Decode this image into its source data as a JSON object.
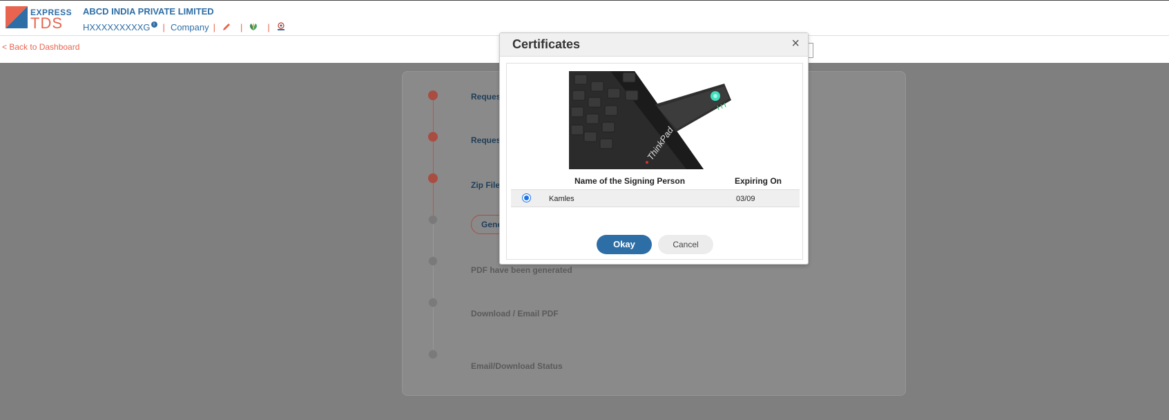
{
  "header": {
    "logo_top": "EXPRESS",
    "logo_bottom": "TDS",
    "company_name": "ABCD INDIA PRIVATE LIMITED",
    "pan": "HXXXXXXXXXG",
    "entity_type": "Company",
    "icons": [
      "edit-icon",
      "leaf-icon",
      "emblem-icon"
    ]
  },
  "nav": {
    "back_label": "< Back to Dashboard"
  },
  "steps": [
    {
      "label": "Request",
      "status": "done"
    },
    {
      "label": "Request",
      "status": "done"
    },
    {
      "label": "Zip File",
      "status": "done"
    },
    {
      "label": "Gene",
      "status": "pending",
      "is_button": true
    },
    {
      "label": "PDF have been generated",
      "status": "pending"
    },
    {
      "label": "Download / Email PDF",
      "status": "pending"
    },
    {
      "label": "Email/Download Status",
      "status": "pending"
    }
  ],
  "modal": {
    "title": "Certificates",
    "close_label": "×",
    "table": {
      "columns": [
        "Name of the Signing Person",
        "Expiring On"
      ],
      "rows": [
        {
          "selected": true,
          "name": "Kamles",
          "expiring_on": "03/09"
        }
      ]
    },
    "okay_label": "Okay",
    "cancel_label": "Cancel"
  },
  "colors": {
    "brand_blue": "#2e6ea6",
    "brand_orange": "#e8644f",
    "overlay_gray": "#7f7f7f"
  }
}
